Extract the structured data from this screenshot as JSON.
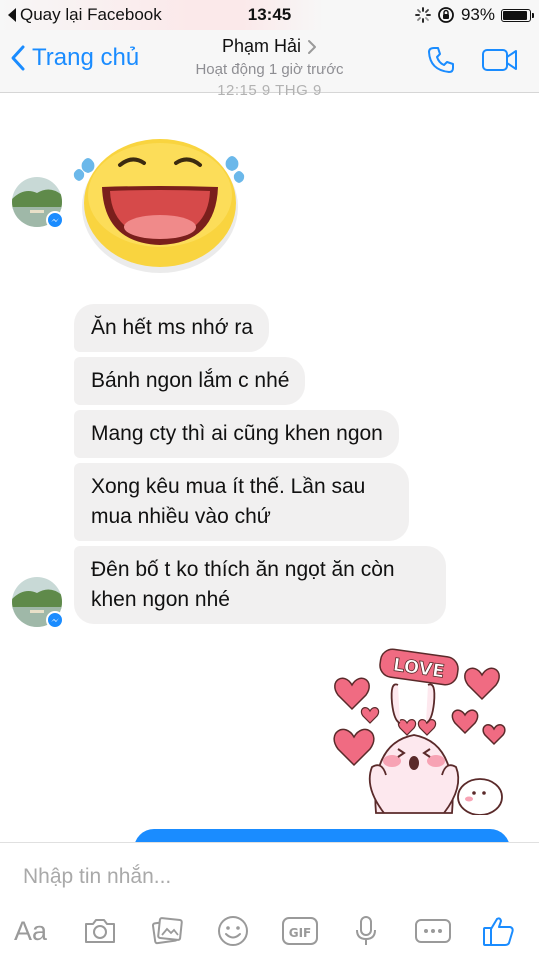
{
  "status_bar": {
    "back_app": "Quay lại Facebook",
    "time": "13:45",
    "battery_text": "93%",
    "battery_level": 0.93
  },
  "nav": {
    "back_label": "Trang chủ",
    "contact_name": "Phạm Hải",
    "contact_status": "Hoạt động 1 giờ trước"
  },
  "conversation": {
    "timestamp": "12:15 9 THG 9",
    "messages": [
      "Ăn hết ms nhớ ra",
      "Bánh ngon lắm c nhé",
      "Mang cty thì ai cũng khen ngon",
      "Xong kêu mua ít thế. Lần sau mua nhiều vào chứ",
      "Đên bố t ko thích ăn ngọt ăn còn khen ngon nhé"
    ],
    "sticker_text": "LOVE"
  },
  "composer": {
    "placeholder": "Nhập tin nhắn...",
    "aa_label": "Aa",
    "gif_label": "GIF"
  },
  "colors": {
    "accent": "#1a8cff",
    "bubble_gray": "#f1f0f0",
    "icon_gray": "#9a9a9a"
  }
}
